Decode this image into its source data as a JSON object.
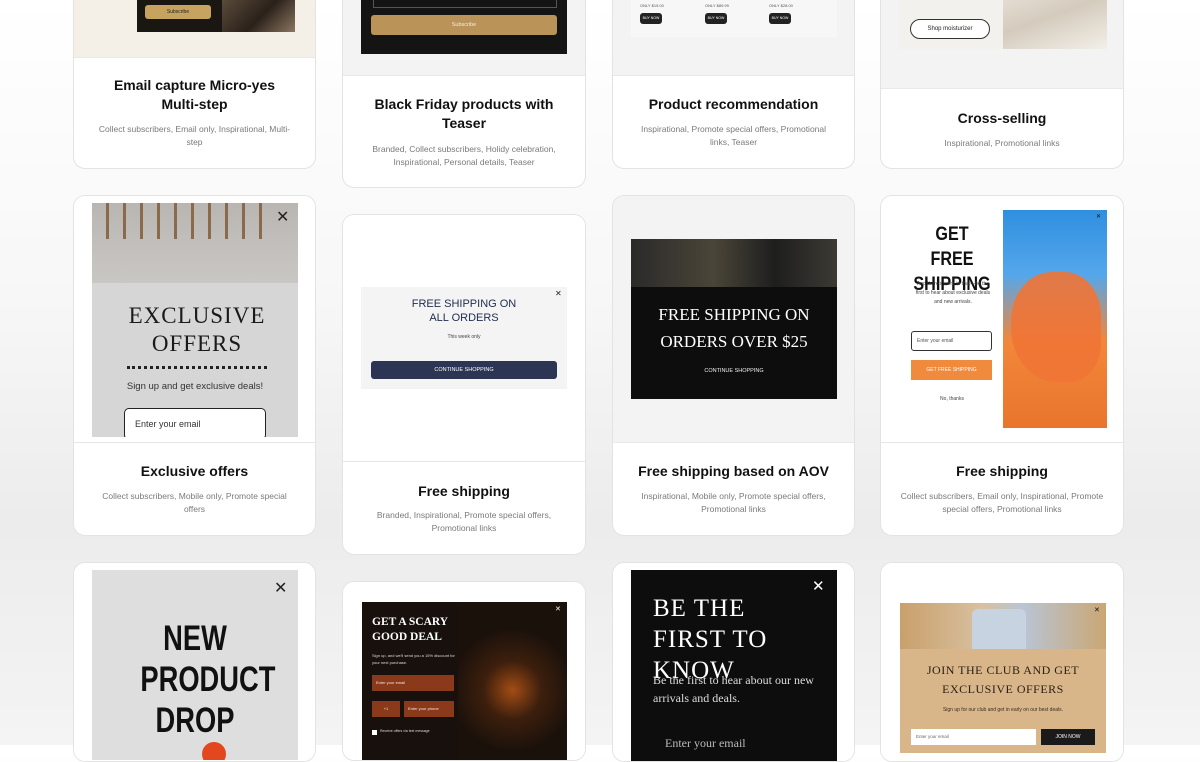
{
  "colors": {
    "card_border": "#e3e3e3",
    "tag_text": "#7a7a7a",
    "navy_button": "#2c3654",
    "orange_accent": "#f08a3c",
    "dark_panel": "#0d0d0d",
    "gold_button": "#c6a45f"
  },
  "templates": [
    {
      "title": "Email capture Micro-yes Multi-step",
      "tags": "Collect subscribers, Email only, Inspirational, Multi-step",
      "preview": {
        "button": "Subscribe"
      }
    },
    {
      "title": "Black Friday products with Teaser",
      "tags": "Branded, Collect subscribers, Holidy celebration, Inspirational, Personal details, Teaser",
      "preview": {
        "button": "Subscribe"
      }
    },
    {
      "title": "Product recommendation",
      "tags": "Inspirational, Promote special offers, Promotional links, Teaser",
      "preview": {
        "prices": [
          "ONLY $15.00",
          "ONLY $89.99",
          "ONLY $28.00"
        ],
        "button": "BUY NOW"
      }
    },
    {
      "title": "Cross-selling",
      "tags": "Inspirational, Promotional links",
      "preview": {
        "button": "Shop moisturizer"
      }
    },
    {
      "title": "Exclusive offers",
      "tags": "Collect subscribers, Mobile only, Promote special offers",
      "preview": {
        "heading": "EXCLUSIVE OFFERS",
        "subtext": "Sign up and get exclusive deals!",
        "placeholder": "Enter your email"
      }
    },
    {
      "title": "Free shipping",
      "tags": "Branded, Inspirational, Promote special offers, Promotional links",
      "preview": {
        "heading": "FREE SHIPPING ON ALL ORDERS",
        "subtext": "This week only",
        "button": "CONTINUE SHOPPING"
      }
    },
    {
      "title": "Free shipping based on AOV",
      "tags": "Inspirational, Mobile only, Promote special offers, Promotional links",
      "preview": {
        "heading": "FREE SHIPPING ON ORDERS OVER $25",
        "button": "CONTINUE SHOPPING"
      }
    },
    {
      "title": "Free shipping",
      "tags": "Collect subscribers, Email only, Inspirational, Promote special offers, Promotional links",
      "preview": {
        "heading": "GET FREE SHIPPING",
        "subtext": "And there's more to that—be the first to hear about exclusive deals and new arrivals.",
        "placeholder": "Enter your email",
        "button": "GET FREE SHIPPING",
        "dismiss": "No, thanks"
      }
    },
    {
      "title": "",
      "tags": "",
      "preview": {
        "heading": "NEW PRODUCT DROP"
      }
    },
    {
      "title": "",
      "tags": "",
      "preview": {
        "heading": "GET A SCARY GOOD DEAL",
        "subtext": "Sign up, and we'll send you a 15% discount for your next purchase.",
        "placeholder": "Enter your email",
        "code": "+1",
        "phone_placeholder": "Enter your phone",
        "consent": "Receive offers via text message"
      }
    },
    {
      "title": "",
      "tags": "",
      "preview": {
        "heading": "BE THE FIRST TO KNOW",
        "subtext": "Be the first to hear about our new arrivals and deals.",
        "placeholder": "Enter your email"
      }
    },
    {
      "title": "",
      "tags": "",
      "preview": {
        "heading": "JOIN THE CLUB AND GET EXCLUSIVE OFFERS",
        "subtext": "Sign up for our club and get in early on our best deals.",
        "placeholder": "Enter your email",
        "button": "JOIN NOW"
      }
    }
  ]
}
